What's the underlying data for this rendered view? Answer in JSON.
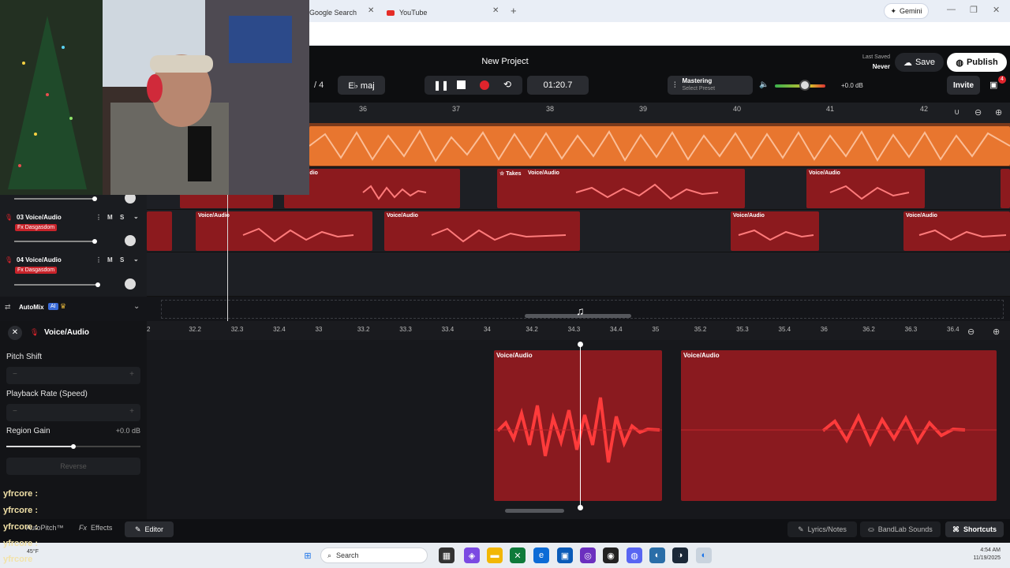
{
  "browser": {
    "tabs": [
      {
        "label": "Google Search",
        "icon": "google-icon"
      },
      {
        "label": "YouTube",
        "icon": "youtube-icon"
      }
    ],
    "gemini_label": "Gemini"
  },
  "app": {
    "project_title": "New Project",
    "last_saved_label": "Last Saved",
    "last_saved_value": "Never",
    "save_label": "Save",
    "publish_label": "Publish",
    "invite_label": "Invite",
    "gift_badge": "4",
    "time_sig_fragment": "/ 4",
    "key_label": "E♭ maj",
    "time_display": "01:20.7",
    "mastering_title": "Mastering",
    "mastering_sub": "Select Preset",
    "volume_db": "+0.0 dB",
    "volume_level": 0.6
  },
  "ruler_ticks": [
    "36",
    "37",
    "38",
    "39",
    "40",
    "41",
    "42"
  ],
  "tracks": [
    {
      "name": "03 Voice/Audio",
      "fx": "Fx Dasgasdom",
      "m": "M",
      "s": "S"
    },
    {
      "name": "04 Voice/Audio",
      "fx": "Fx Dasgasdom",
      "m": "M",
      "s": "S"
    }
  ],
  "clip_label": "Voice/Audio",
  "takes_label": "Takes",
  "automix": {
    "label": "AutoMix",
    "ai": "AI"
  },
  "editor": {
    "title": "Voice/Audio",
    "pitch_shift": "Pitch Shift",
    "playback_rate": "Playback Rate (Speed)",
    "region_gain": "Region Gain",
    "region_gain_value": "+0.0 dB",
    "reverse": "Reverse",
    "ticks": [
      "2",
      "32.2",
      "32.3",
      "32.4",
      "33",
      "33.2",
      "33.3",
      "33.4",
      "34",
      "34.2",
      "34.3",
      "34.4",
      "35",
      "35.2",
      "35.3",
      "35.4",
      "36",
      "36.2",
      "36.3",
      "36.4"
    ]
  },
  "bottom": {
    "autopitch": "AutoPitch™",
    "effects": "Effects",
    "editor": "Editor",
    "lyrics": "Lyrics/Notes",
    "sounds": "BandLab Sounds",
    "shortcuts": "Shortcuts"
  },
  "chat": [
    "yfrcore :",
    "yfrcore :",
    "yfrcore :",
    "yfrcore :",
    "yfrcore"
  ],
  "taskbar": {
    "search": "Search",
    "time": "4:54 AM",
    "date": "11/19/2025",
    "weather": "45°F"
  }
}
